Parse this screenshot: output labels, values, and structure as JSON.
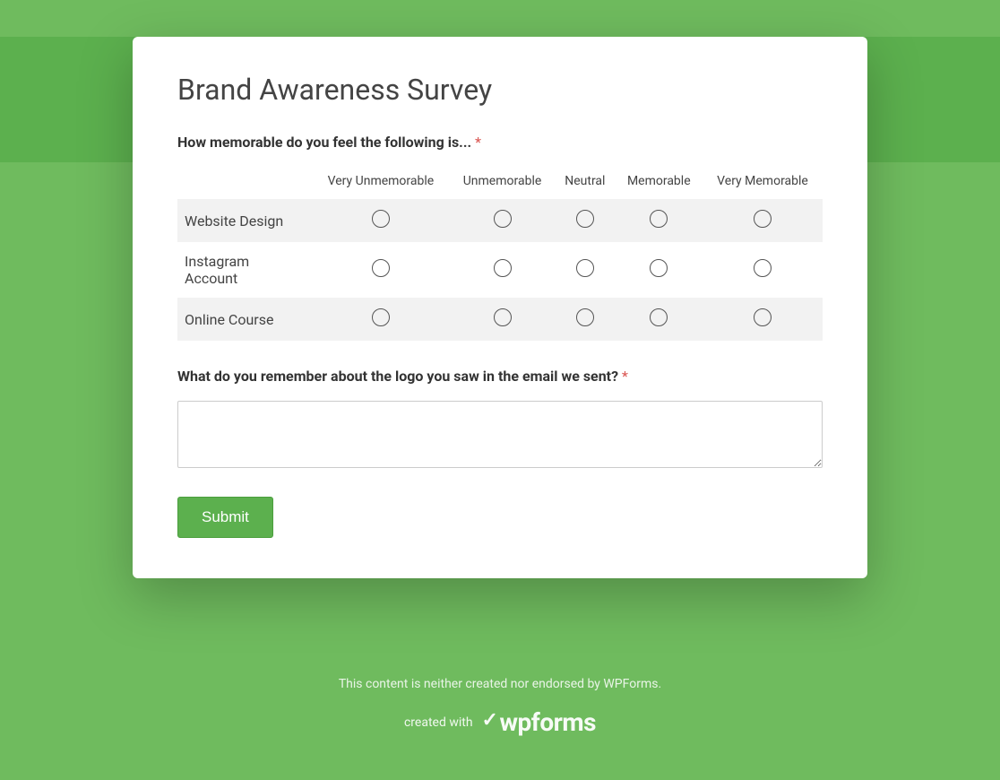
{
  "title": "Brand Awareness Survey",
  "q1": {
    "label": "How memorable do you feel the following is...",
    "required": "*",
    "columns": [
      "Very Unmemorable",
      "Unmemorable",
      "Neutral",
      "Memorable",
      "Very Memorable"
    ],
    "rows": [
      "Website Design",
      "Instagram Account",
      "Online Course"
    ]
  },
  "q2": {
    "label": "What do you remember about the logo you saw in the email we sent?",
    "required": "*"
  },
  "submit_label": "Submit",
  "footer": {
    "disclaimer": "This content is neither created nor endorsed by WPForms.",
    "created_with": "created with",
    "brand": "wpforms"
  }
}
